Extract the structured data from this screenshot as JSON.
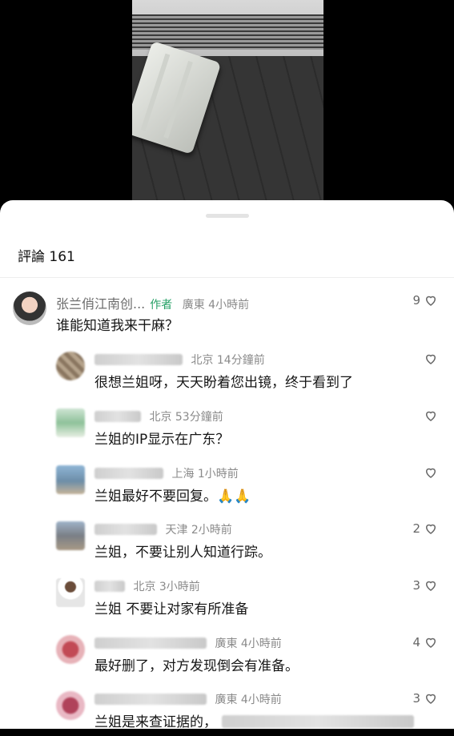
{
  "comments_header": {
    "label": "評論 161"
  },
  "main_comment": {
    "name": "张兰俏江南创...",
    "tag": "作者",
    "meta": "廣東 4小時前",
    "text": "谁能知道我来干麻？",
    "likes": "9"
  },
  "replies": [
    {
      "meta": "北京 14分鐘前",
      "text": "很想兰姐呀，天天盼着您出镜，终于看到了",
      "likes": ""
    },
    {
      "meta": "北京 53分鐘前",
      "text": "兰姐的IP显示在广东？",
      "likes": ""
    },
    {
      "meta": "上海 1小時前",
      "text": "兰姐最好不要回复。🙏🙏",
      "likes": ""
    },
    {
      "meta": "天津 2小時前",
      "text": "兰姐，不要让别人知道行踪。",
      "likes": "2"
    },
    {
      "meta": "北京 3小時前",
      "text": "兰姐 不要让对家有所准备",
      "likes": "3"
    },
    {
      "meta": "廣東 4小時前",
      "text": "最好删了，对方发现倒会有准备。",
      "likes": "4"
    },
    {
      "meta": "廣東 4小時前",
      "text": "兰姐是来查证据的，",
      "likes": "3"
    }
  ]
}
